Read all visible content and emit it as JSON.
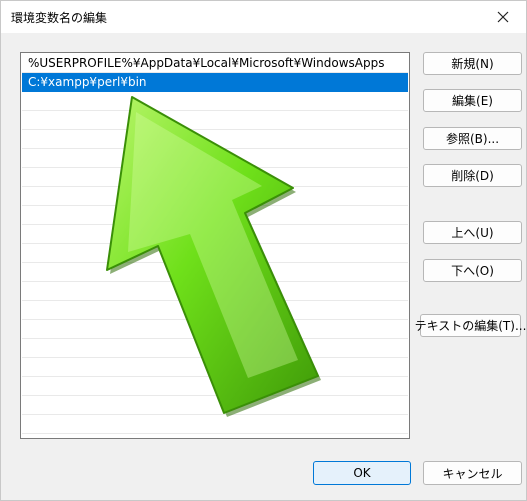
{
  "window": {
    "title": "環境変数名の編集",
    "close_icon": "close-icon"
  },
  "list": {
    "items": [
      {
        "text": "%USERPROFILE%¥AppData¥Local¥Microsoft¥WindowsApps",
        "selected": false
      },
      {
        "text": "C:¥xampp¥perl¥bin",
        "selected": true
      }
    ],
    "empty_rows": 16
  },
  "buttons": {
    "new": "新規(N)",
    "edit": "編集(E)",
    "browse": "参照(B)...",
    "delete": "削除(D)",
    "move_up": "上へ(U)",
    "move_down": "下へ(O)",
    "edit_text": "テキストの編集(T)...",
    "ok": "OK",
    "cancel": "キャンセル"
  },
  "colors": {
    "selection": "#0078d7",
    "arrow_green": "#6fe01a",
    "arrow_dark": "#3f9a08"
  }
}
